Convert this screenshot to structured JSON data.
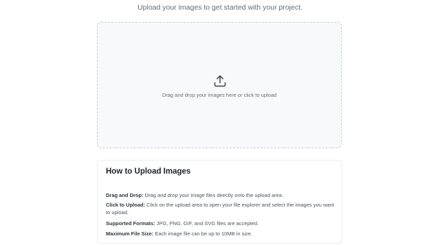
{
  "header": {
    "subtitle": "Upload your images to get started with your project."
  },
  "dropzone": {
    "icon": "upload-icon",
    "text": "Drag and drop your images here or click to upload"
  },
  "help": {
    "title": "How to Upload Images",
    "items": [
      {
        "term": "Drag and Drop:",
        "text": " Drag and drop your image files directly onto the upload area."
      },
      {
        "term": "Click to Upload:",
        "text": " Click on the upload area to open your file explorer and select the images you want to upload."
      },
      {
        "term": "Supported Formats:",
        "text": " JPG, PNG, GIF, and SVG files are accepted."
      },
      {
        "term": "Maximum File Size:",
        "text": " Each image file can be up to 10MB in size."
      }
    ]
  }
}
